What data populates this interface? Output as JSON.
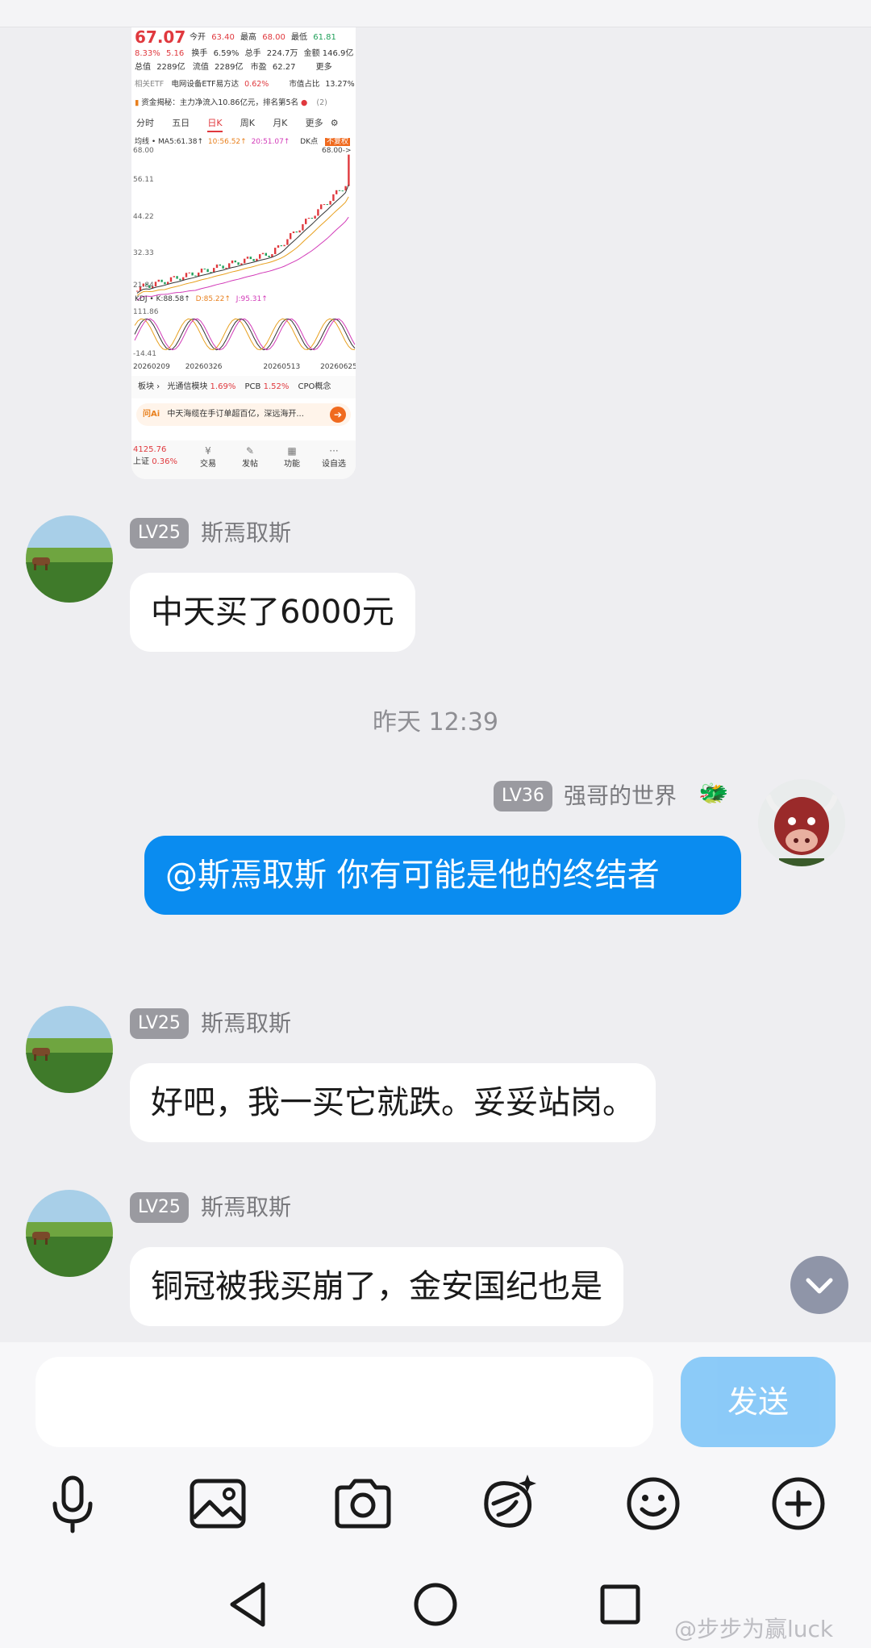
{
  "stock": {
    "price": "67.07",
    "change_pct": "8.33%",
    "change": "5.16",
    "stats_row1": [
      {
        "label": "今开",
        "value": "63.40"
      },
      {
        "label": "最高",
        "value": "68.00"
      },
      {
        "label": "最低",
        "value": "61.81"
      }
    ],
    "stats_row2": [
      {
        "label": "换手",
        "value": "6.59%"
      },
      {
        "label": "总手",
        "value": "224.7万"
      },
      {
        "label": "金额",
        "value": "146.9亿"
      }
    ],
    "stats_row3": [
      {
        "label": "总值",
        "value": "2289亿"
      },
      {
        "label": "流值",
        "value": "2289亿"
      },
      {
        "label": "市盈",
        "value": "62.27"
      }
    ],
    "more": "更多",
    "etf_label": "相关ETF",
    "etf_name": "电网设备ETF易方达",
    "etf_pct": "0.62%",
    "etf_share_label": "市值占比",
    "etf_share": "13.27%",
    "fund_flow": "资金揭秘：主力净流入10.86亿元，排名第5名",
    "fund_flow_count": "(2)",
    "tabs": [
      "分时",
      "五日",
      "日K",
      "周K",
      "月K",
      "更多"
    ],
    "active_tab": "日K",
    "ma_line": "均线 • MA5:61.38↑",
    "ma10": "10:56.52↑",
    "ma20": "20:51.07↑",
    "dk": "DK点",
    "fq": "不复权",
    "y_ticks": [
      "68.00",
      "56.11",
      "44.22",
      "32.33",
      "21.84"
    ],
    "y_top_right": "68.00->",
    "kdj_label": "KDJ • K:88.58↑",
    "kdj_d": "D:85.22↑",
    "kdj_j": "J:95.31↑",
    "kdj_top": "111.86",
    "kdj_bottom": "-14.41",
    "dates": [
      "20260209",
      "20260326",
      "20260513",
      "20260625"
    ],
    "sector_label": "板块",
    "sector1": "光通信模块",
    "sector1_pct": "1.69%",
    "sector2": "PCB",
    "sector2_pct": "1.52%",
    "sector3": "CPO概念",
    "ai_badge": "问Ai",
    "ai_text": "中天海缆在手订单超百亿，深远海开...",
    "index_value": "4125.76",
    "index_name": "上证",
    "index_pct": "0.36%",
    "nav": [
      "交易",
      "发帖",
      "功能",
      "设自选"
    ]
  },
  "chart_data": {
    "type": "candlestick-line",
    "ylim": [
      21.84,
      68.0
    ],
    "y_ticks": [
      68.0,
      56.11,
      44.22,
      32.33,
      21.84
    ],
    "x_ticks": [
      "20260209",
      "20260326",
      "20260513",
      "20260625"
    ],
    "last_close": 67.07,
    "ma5": 61.38,
    "ma10": 56.52,
    "ma20": 51.07,
    "kdj": {
      "K": 88.58,
      "D": 85.22,
      "J": 95.31,
      "ylim": [
        -14.41,
        111.86
      ]
    }
  },
  "messages": [
    {
      "level": "LV25",
      "name": "斯焉取斯",
      "text": "中天买了6000元"
    },
    {
      "level": "LV36",
      "name": "强哥的世界",
      "text": "@斯焉取斯 你有可能是他的终结者"
    },
    {
      "level": "LV25",
      "name": "斯焉取斯",
      "text": "好吧，我一买它就跌。妥妥站岗。"
    },
    {
      "level": "LV25",
      "name": "斯焉取斯",
      "text": "铜冠被我买崩了，金安国纪也是"
    }
  ],
  "timestamp": "昨天 12:39",
  "composer": {
    "placeholder": "",
    "send_label": "发送"
  },
  "watermark": "@步步为赢luck",
  "colors": {
    "accent": "#0a8cf0",
    "send_disabled": "#86c8f8",
    "up": "#e0393e",
    "down": "#20a05a"
  }
}
